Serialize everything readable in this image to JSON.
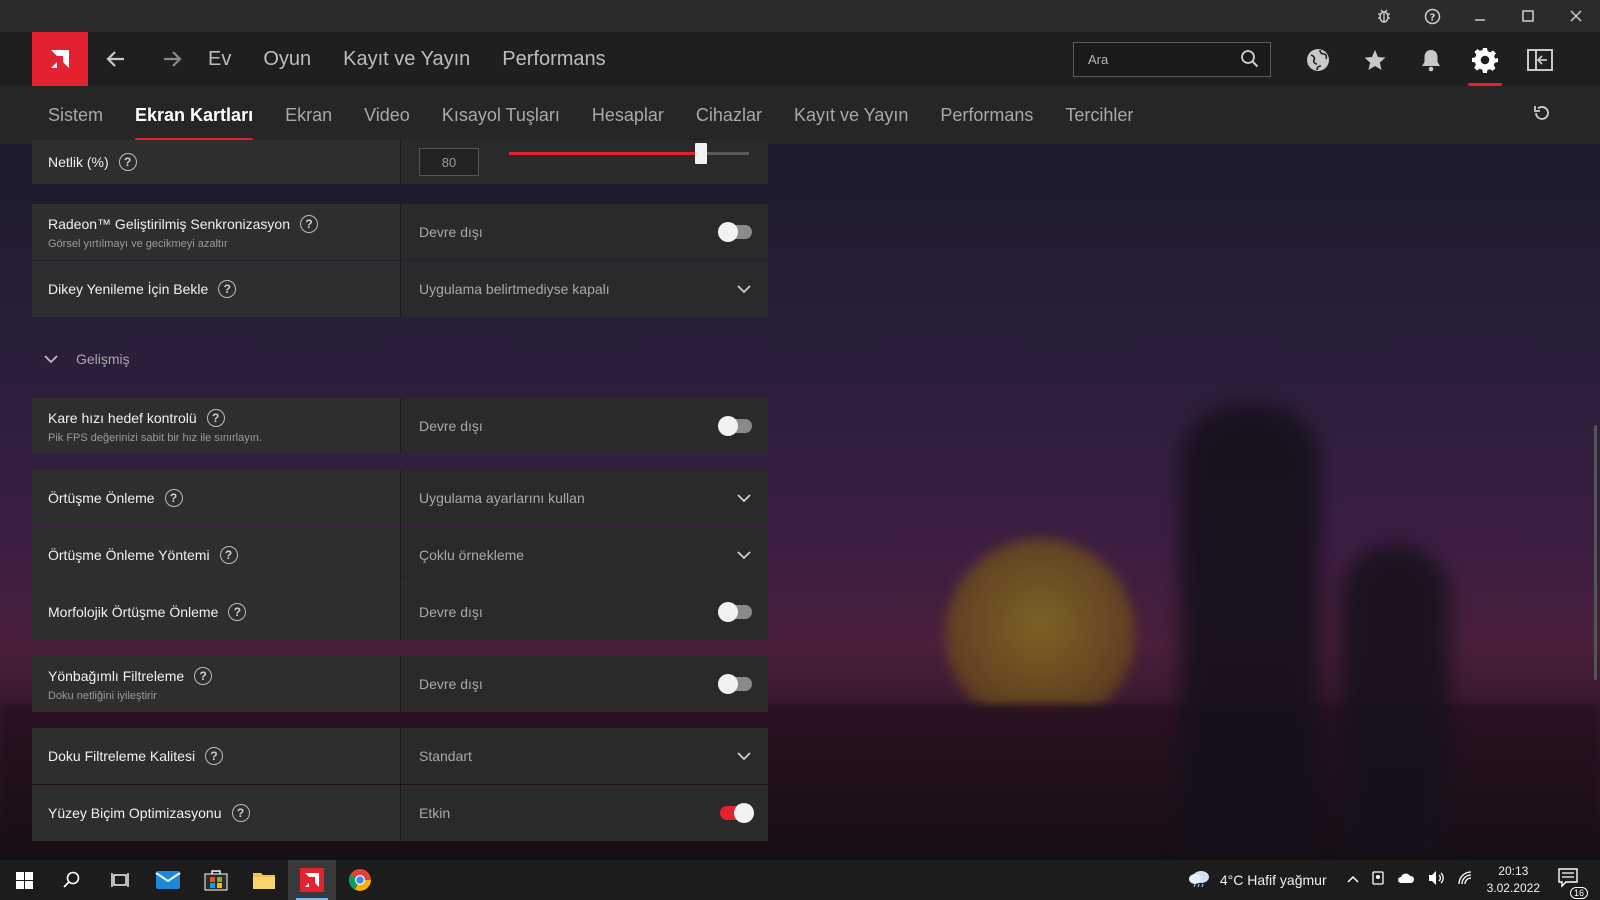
{
  "window": {
    "controls": [
      "bug-report",
      "help",
      "minimize",
      "maximize",
      "close"
    ]
  },
  "nav": {
    "links": [
      "Ev",
      "Oyun",
      "Kayıt ve Yayın",
      "Performans"
    ],
    "search_placeholder": "Ara"
  },
  "tabs": {
    "items": [
      "Sistem",
      "Ekran Kartları",
      "Ekran",
      "Video",
      "Kısayol Tuşları",
      "Hesaplar",
      "Cihazlar",
      "Kayıt ve Yayın",
      "Performans",
      "Tercihler"
    ],
    "active": "Ekran Kartları"
  },
  "settings": {
    "netlik": {
      "label": "Netlik (%)",
      "value": "80",
      "percent": 80
    },
    "radeon_sync": {
      "label": "Radeon™ Geliştirilmiş Senkronizasyon",
      "sub": "Görsel yırtılmayı ve gecikmeyi azaltır",
      "value": "Devre dışı"
    },
    "vsync": {
      "label": "Dikey Yenileme İçin Bekle",
      "value": "Uygulama belirtmediyse kapalı"
    },
    "advanced_label": "Gelişmiş",
    "frame_rate": {
      "label": "Kare hızı hedef kontrolü",
      "sub": "Pik FPS değerinizi sabit bir hız ile sınırlayın.",
      "value": "Devre dışı"
    },
    "anti_aliasing": {
      "label": "Örtüşme Önleme",
      "value": "Uygulama ayarlarını kullan"
    },
    "aa_method": {
      "label": "Örtüşme Önleme Yöntemi",
      "value": "Çoklu örnekleme"
    },
    "morphological": {
      "label": "Morfolojik Örtüşme Önleme",
      "value": "Devre dışı"
    },
    "anisotropic": {
      "label": "Yönbağımlı Filtreleme",
      "sub": "Doku netliğini iyileştirir",
      "value": "Devre dışı"
    },
    "texture_quality": {
      "label": "Doku Filtreleme Kalitesi",
      "value": "Standart"
    },
    "surface_format": {
      "label": "Yüzey Biçim Optimizasyonu",
      "value": "Etkin"
    }
  },
  "taskbar": {
    "weather": "4°C  Hafif yağmur",
    "time": "20:13",
    "date": "3.02.2022",
    "notifications": "16"
  },
  "colors": {
    "accent": "#e4212f",
    "panel": "#2e2e2e",
    "nav": "#1f1f1f"
  }
}
